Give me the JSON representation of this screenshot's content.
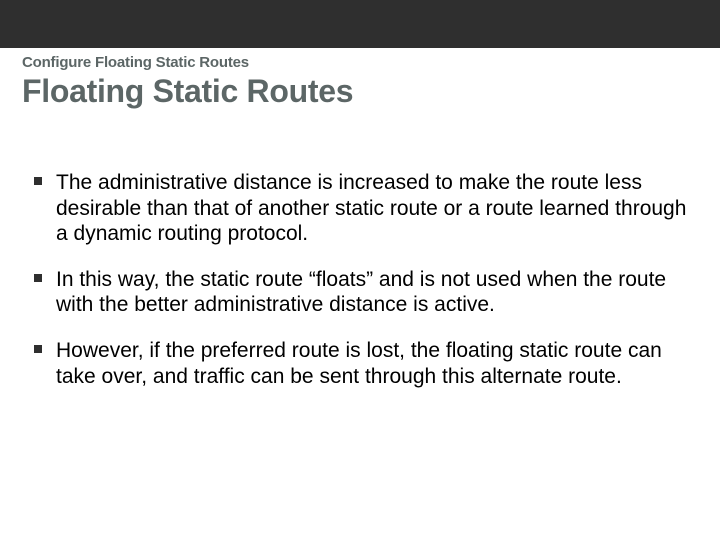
{
  "header": {
    "kicker": "Configure Floating Static Routes",
    "title": "Floating Static Routes"
  },
  "body": {
    "bullets": [
      "The administrative distance is increased to make the route less desirable than that of another static route or a route learned through a dynamic routing protocol.",
      "In this way, the static route “floats” and is not used when the route with the better administrative distance is active.",
      "However, if the preferred route is lost, the floating static route can take over, and traffic can be sent through this alternate route."
    ]
  }
}
